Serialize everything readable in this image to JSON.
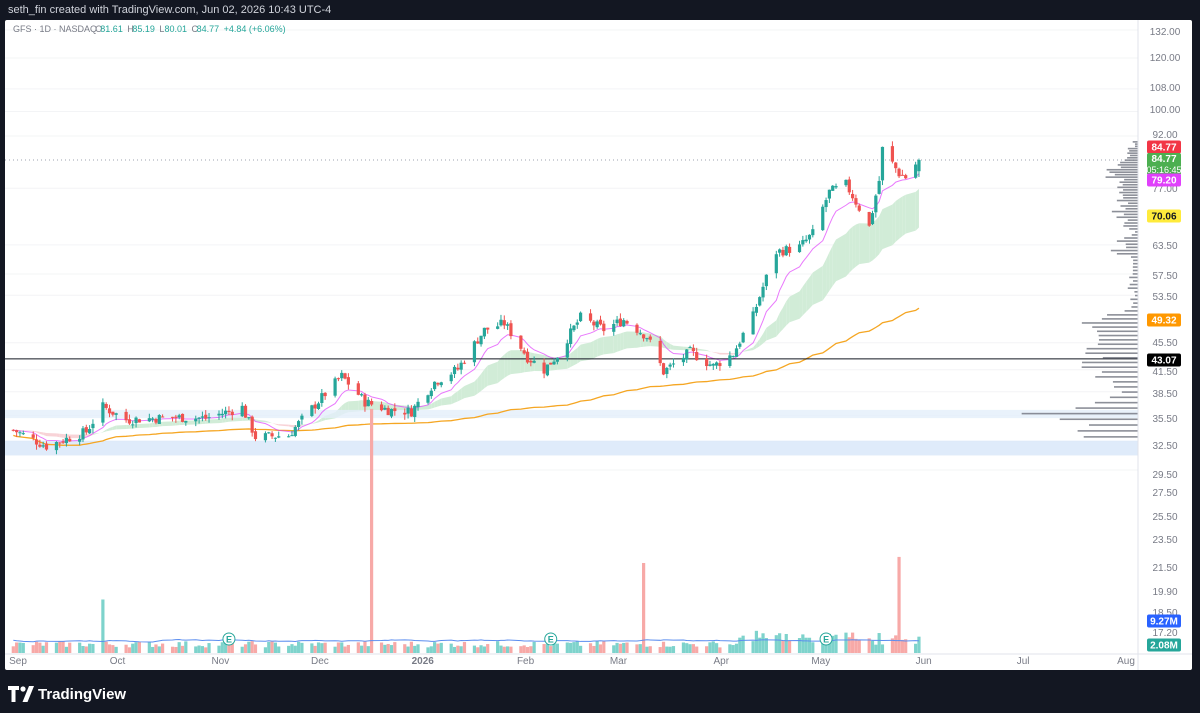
{
  "header": {
    "caption": "seth_fin created with TradingView.com, Jun 02, 2026 10:43 UTC-4"
  },
  "legend": {
    "symbol": "GFS · 1D · NASDAQ",
    "o_key": "O",
    "o": "81.61",
    "h_key": "H",
    "h": "85.19",
    "l_key": "L",
    "l": "80.01",
    "c_key": "C",
    "c": "84.77",
    "change": "+4.84 (+6.06%)"
  },
  "footer": {
    "brand": "TradingView"
  },
  "colors": {
    "up": "#26a69a",
    "down": "#ef5350",
    "ema_short": "#e040fb",
    "ma_long": "#f5a623",
    "ribbon": "#d1ecd7"
  },
  "chart_data": {
    "type": "candlestick",
    "symbol": "GFS",
    "interval": "1D",
    "exchange": "NASDAQ",
    "scale": "log",
    "y_ticks": [
      "132.00",
      "120.00",
      "108.00",
      "100.00",
      "92.00",
      "77.00",
      "63.50",
      "57.50",
      "53.50",
      "45.50",
      "41.50",
      "38.50",
      "35.50",
      "32.50",
      "29.50",
      "27.50",
      "25.50",
      "23.50",
      "21.50",
      "19.90",
      "18.50",
      "17.20"
    ],
    "ylim": [
      29.5,
      132
    ],
    "x_labels": [
      "Sep",
      "Oct",
      "Nov",
      "Dec",
      "2026",
      "Feb",
      "Mar",
      "Apr",
      "May",
      "Jun",
      "Jul",
      "Aug"
    ],
    "price_labels": [
      {
        "value": "84.77",
        "sub": "",
        "color": "#f23645"
      },
      {
        "value": "84.77",
        "sub": "05:16:45",
        "color": "#4caf50"
      },
      {
        "value": "79.20",
        "sub": "",
        "color": "#e040fb"
      },
      {
        "value": "70.06",
        "sub": "",
        "color": "#ffeb3b"
      },
      {
        "value": "49.32",
        "sub": "",
        "color": "#ff9800"
      },
      {
        "value": "43.07",
        "sub": "",
        "color": "#000000"
      },
      {
        "value": "9.27M",
        "sub": "",
        "color": "#2962ff"
      },
      {
        "value": "2.08M",
        "sub": "",
        "color": "#26a69a"
      }
    ],
    "key_levels": {
      "last": 84.77,
      "ema_short": 79.2,
      "ribbon_top": 70.06,
      "ma_long": 49.32,
      "horizontal_line": 43.07
    },
    "volume_last": "2.08M",
    "volume_ma": "9.27M",
    "earnings_marker": "E",
    "anchors": [
      {
        "date": "2025-09-02",
        "price": 33.8
      },
      {
        "date": "2025-09-12",
        "price": 32.0
      },
      {
        "date": "2025-09-24",
        "price": 33.6
      },
      {
        "date": "2025-09-29",
        "price": 36.6
      },
      {
        "date": "2025-10-06",
        "price": 35.0
      },
      {
        "date": "2025-10-20",
        "price": 35.3
      },
      {
        "date": "2025-10-30",
        "price": 35.2
      },
      {
        "date": "2025-11-10",
        "price": 36.5
      },
      {
        "date": "2025-11-14",
        "price": 33.0
      },
      {
        "date": "2025-11-24",
        "price": 33.2
      },
      {
        "date": "2025-12-03",
        "price": 37.3
      },
      {
        "date": "2025-12-10",
        "price": 40.6
      },
      {
        "date": "2025-12-17",
        "price": 37.2
      },
      {
        "date": "2025-12-24",
        "price": 36.2
      },
      {
        "date": "2025-12-31",
        "price": 36.0
      },
      {
        "date": "2026-01-07",
        "price": 39.8
      },
      {
        "date": "2026-01-14",
        "price": 41.6
      },
      {
        "date": "2026-01-22",
        "price": 47.5
      },
      {
        "date": "2026-01-28",
        "price": 48.6
      },
      {
        "date": "2026-02-04",
        "price": 43.3
      },
      {
        "date": "2026-02-09",
        "price": 41.5
      },
      {
        "date": "2026-02-13",
        "price": 43.6
      },
      {
        "date": "2026-02-20",
        "price": 49.6
      },
      {
        "date": "2026-02-27",
        "price": 47.6
      },
      {
        "date": "2026-03-05",
        "price": 49.2
      },
      {
        "date": "2026-03-12",
        "price": 46.5
      },
      {
        "date": "2026-03-17",
        "price": 41.2
      },
      {
        "date": "2026-03-25",
        "price": 44.1
      },
      {
        "date": "2026-04-01",
        "price": 42.0
      },
      {
        "date": "2026-04-07",
        "price": 43.8
      },
      {
        "date": "2026-04-13",
        "price": 49.8
      },
      {
        "date": "2026-04-20",
        "price": 62.0
      },
      {
        "date": "2026-04-27",
        "price": 63.0
      },
      {
        "date": "2026-05-01",
        "price": 66.0
      },
      {
        "date": "2026-05-06",
        "price": 76.0
      },
      {
        "date": "2026-05-11",
        "price": 78.0
      },
      {
        "date": "2026-05-14",
        "price": 73.5
      },
      {
        "date": "2026-05-18",
        "price": 67.5
      },
      {
        "date": "2026-05-21",
        "price": 79.0
      },
      {
        "date": "2026-05-22",
        "price": 88.0
      },
      {
        "date": "2026-05-27",
        "price": 81.0
      },
      {
        "date": "2026-05-29",
        "price": 79.9
      },
      {
        "date": "2026-06-02",
        "price": 84.77
      }
    ],
    "volume_spikes": [
      {
        "date": "2025-12-19",
        "value": 27.5
      },
      {
        "date": "2026-03-11",
        "value": 19.9
      },
      {
        "date": "2026-05-27",
        "value": 20.2
      },
      {
        "date": "2025-09-29",
        "value": 18.1
      }
    ]
  }
}
